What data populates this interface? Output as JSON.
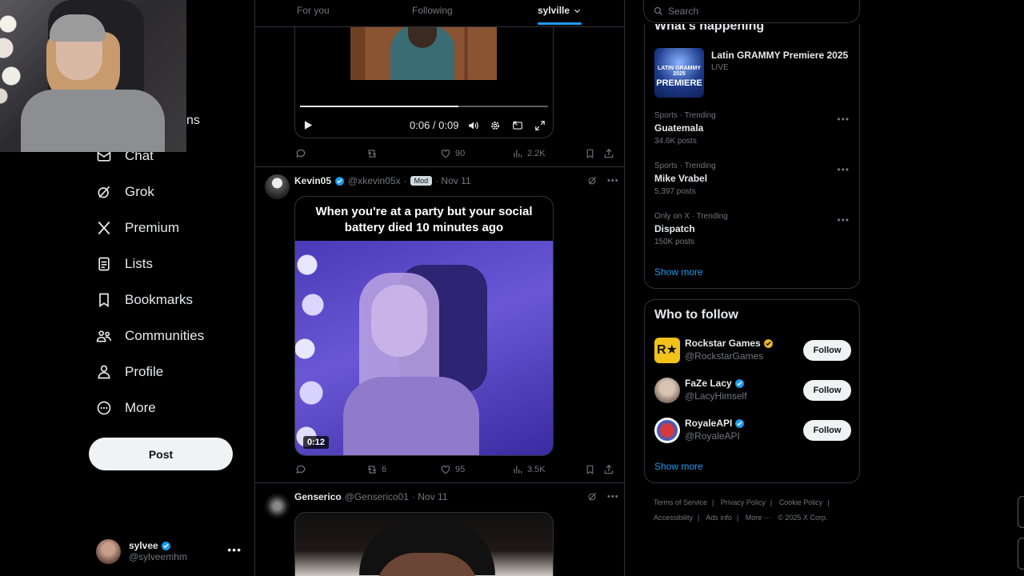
{
  "nav": {
    "cut_label": "ns",
    "items": [
      {
        "label": "Chat",
        "icon": "envelope-icon"
      },
      {
        "label": "Grok",
        "icon": "grok-icon"
      },
      {
        "label": "Premium",
        "icon": "x-logo-icon"
      },
      {
        "label": "Lists",
        "icon": "list-icon"
      },
      {
        "label": "Bookmarks",
        "icon": "bookmark-icon"
      },
      {
        "label": "Communities",
        "icon": "communities-icon"
      },
      {
        "label": "Profile",
        "icon": "person-icon"
      },
      {
        "label": "More",
        "icon": "more-circle-icon"
      }
    ],
    "post_button": "Post"
  },
  "account": {
    "name": "sylvee",
    "handle": "@sylveemhm"
  },
  "tabs": [
    {
      "label": "For you"
    },
    {
      "label": "Following"
    },
    {
      "label": "sylville"
    }
  ],
  "video_player": {
    "time": "0:06 / 0:09",
    "progress": 0.64
  },
  "tweet1_actions": {
    "replies": "",
    "retweets": "",
    "likes": "90",
    "views": "2.2K"
  },
  "tweet2": {
    "name": "Kevin05",
    "handle": "@xkevin05x",
    "badge": "Mod",
    "date": "· Nov 11",
    "caption": "When you're at a party but your social battery died 10 minutes ago",
    "duration": "0:12",
    "actions": {
      "replies": "",
      "retweets": "6",
      "likes": "95",
      "views": "3.5K"
    }
  },
  "tweet3": {
    "name": "Genserico",
    "handle": "@Genserico01",
    "date": "· Nov 11"
  },
  "search": {
    "placeholder": "Search"
  },
  "happening": {
    "title": "What's happening",
    "featured": {
      "title": "Latin GRAMMY Premiere 2025",
      "status": "LIVE",
      "thumb_small": "LATIN GRAMMY 2025",
      "thumb_big": "PREMIERE"
    },
    "trends": [
      {
        "category": "Sports · Trending",
        "title": "Guatemala",
        "count": "34.6K posts"
      },
      {
        "category": "Sports · Trending",
        "title": "Mike Vrabel",
        "count": "5,397 posts"
      },
      {
        "category": "Only on X · Trending",
        "title": "Dispatch",
        "count": "150K posts"
      }
    ],
    "show_more": "Show more"
  },
  "who_to_follow": {
    "title": "Who to follow",
    "items": [
      {
        "name": "Rockstar Games",
        "handle": "@RockstarGames",
        "badge": "gold",
        "button": "Follow"
      },
      {
        "name": "FaZe Lacy",
        "handle": "@LacyHimself",
        "badge": "blue",
        "button": "Follow"
      },
      {
        "name": "RoyaleAPI",
        "handle": "@RoyaleAPI",
        "badge": "blue",
        "button": "Follow"
      }
    ],
    "show_more": "Show more"
  },
  "footer": {
    "links": [
      "Terms of Service",
      "|",
      "Privacy Policy",
      "|",
      "Cookie Policy",
      "|",
      "Accessibility",
      "|",
      "Ads info",
      "|",
      "More ···",
      "© 2025 X Corp."
    ]
  },
  "colors": {
    "accent": "#1d9bf0",
    "background": "#000000",
    "muted": "#71767b",
    "verified_gold": "#e8b829"
  }
}
